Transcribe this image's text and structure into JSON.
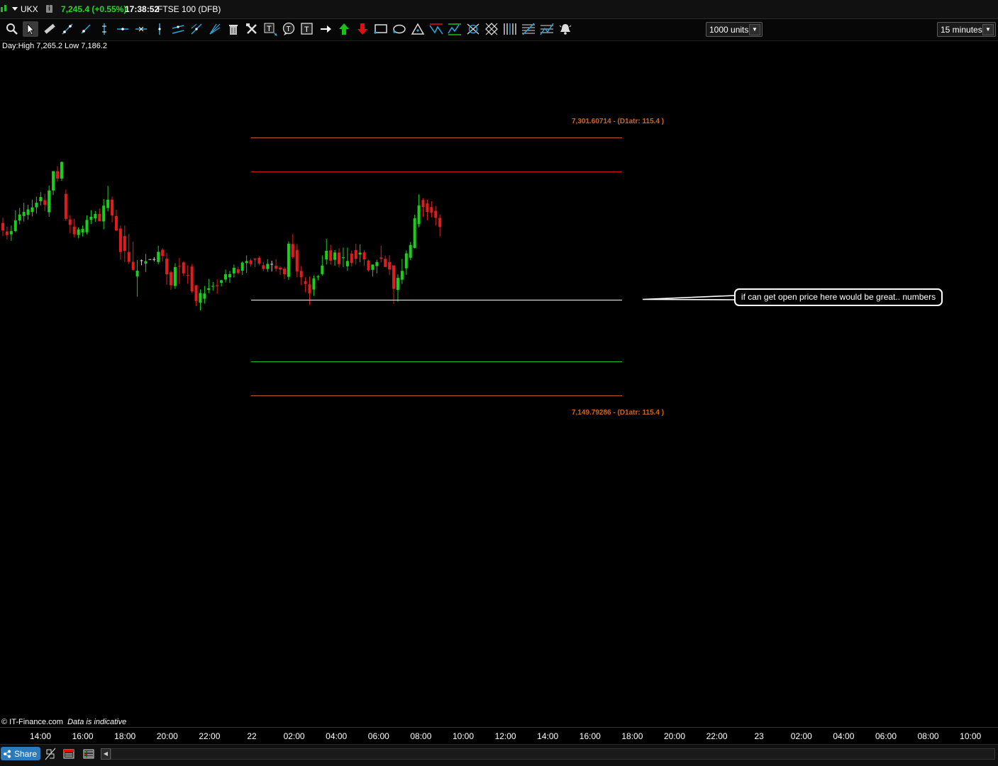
{
  "titlebar": {
    "symbol": "UKX",
    "info_glyph": "i",
    "price_change": "7,245.4 (+0.55%)",
    "time": "17:38:52",
    "instrument": "FTSE 100 (DFB)"
  },
  "toolbar": {
    "units_label": "1000 units",
    "timeframe_label": "15 minutes",
    "text_tool_glyph": "T",
    "colors": {
      "up_arrow": "#19c019",
      "down_arrow": "#e01010",
      "icon": "#2aa9e0"
    }
  },
  "day_high_low": "Day:High 7,265.2 Low 7,186.2",
  "atr_upper_label": "7,301.60714  - (D1atr: 115.4 )",
  "atr_lower_label": "7,149.79286  - (D1atr: 115.4 )",
  "callout_text": "if can get  open price here would be great.. numbers",
  "copyright": "© IT-Finance.com",
  "data_note": "Data is indicative",
  "share_label": "Share",
  "time_axis_labels": [
    "14:00",
    "16:00",
    "18:00",
    "20:00",
    "22:00",
    "22",
    "02:00",
    "04:00",
    "06:00",
    "08:00",
    "10:00",
    "12:00",
    "14:00",
    "16:00",
    "18:00",
    "20:00",
    "22:00",
    "23",
    "02:00",
    "04:00",
    "06:00",
    "08:00",
    "10:00"
  ],
  "chart_data": {
    "type": "candlestick",
    "symbol": "UKX",
    "timeframe": "15 minutes",
    "day_high": 7265.2,
    "day_low": 7186.2,
    "last_price": 7245.4,
    "levels": [
      {
        "name": "atr_upper",
        "value": 7301.60714,
        "color": "#d45f1c"
      },
      {
        "name": "red_line",
        "value": 7285.0,
        "color": "#e01010"
      },
      {
        "name": "open_price",
        "value": 7225.7,
        "color": "#ffffff"
      },
      {
        "name": "green_line",
        "value": 7166.4,
        "color": "#19c019"
      },
      {
        "name": "atr_lower",
        "value": 7149.79286,
        "color": "#d45f1c"
      }
    ],
    "colors": {
      "up": "#19d019",
      "down": "#e01c1c",
      "doji": "#cfcfcf"
    },
    "candles": [
      {
        "o": 7251.5,
        "h": 7254.6,
        "l": 7243.8,
        "c": 7247.1
      },
      {
        "o": 7246.5,
        "h": 7249.3,
        "l": 7241.8,
        "c": 7244.4
      },
      {
        "o": 7244.8,
        "h": 7250.0,
        "l": 7240.9,
        "c": 7246.7
      },
      {
        "o": 7246.7,
        "h": 7259.0,
        "l": 7246.0,
        "c": 7253.0
      },
      {
        "o": 7253.0,
        "h": 7260.4,
        "l": 7250.7,
        "c": 7256.5
      },
      {
        "o": 7255.6,
        "h": 7263.4,
        "l": 7252.4,
        "c": 7258.0
      },
      {
        "o": 7256.3,
        "h": 7262.2,
        "l": 7253.5,
        "c": 7259.5
      },
      {
        "o": 7258.0,
        "h": 7265.2,
        "l": 7255.3,
        "c": 7260.7
      },
      {
        "o": 7260.7,
        "h": 7267.0,
        "l": 7257.0,
        "c": 7263.4
      },
      {
        "o": 7264.3,
        "h": 7269.6,
        "l": 7261.8,
        "c": 7266.8
      },
      {
        "o": 7264.9,
        "h": 7268.6,
        "l": 7258.5,
        "c": 7262.2
      },
      {
        "o": 7257.8,
        "h": 7273.6,
        "l": 7255.1,
        "c": 7270.6
      },
      {
        "o": 7270.6,
        "h": 7281.7,
        "l": 7267.9,
        "c": 7282.0
      },
      {
        "o": 7282.0,
        "h": 7285.0,
        "l": 7275.8,
        "c": 7277.6
      },
      {
        "o": 7277.6,
        "h": 7287.7,
        "l": 7276.3,
        "c": 7287.4
      },
      {
        "o": 7268.6,
        "h": 7271.2,
        "l": 7252.7,
        "c": 7253.9
      },
      {
        "o": 7253.6,
        "h": 7256.2,
        "l": 7245.5,
        "c": 7250.3
      },
      {
        "o": 7249.4,
        "h": 7254.0,
        "l": 7243.1,
        "c": 7244.8
      },
      {
        "o": 7244.4,
        "h": 7248.9,
        "l": 7242.4,
        "c": 7247.7
      },
      {
        "o": 7245.9,
        "h": 7250.0,
        "l": 7243.5,
        "c": 7248.0
      },
      {
        "o": 7246.0,
        "h": 7256.0,
        "l": 7244.8,
        "c": 7253.3
      },
      {
        "o": 7253.3,
        "h": 7259.0,
        "l": 7250.9,
        "c": 7255.1
      },
      {
        "o": 7254.2,
        "h": 7258.5,
        "l": 7252.2,
        "c": 7256.8
      },
      {
        "o": 7256.8,
        "h": 7260.0,
        "l": 7252.4,
        "c": 7252.5
      },
      {
        "o": 7252.4,
        "h": 7265.6,
        "l": 7247.8,
        "c": 7261.7
      },
      {
        "o": 7260.3,
        "h": 7273.3,
        "l": 7258.3,
        "c": 7265.2
      },
      {
        "o": 7265.2,
        "h": 7267.0,
        "l": 7251.9,
        "c": 7255.9
      },
      {
        "o": 7255.6,
        "h": 7259.3,
        "l": 7246.7,
        "c": 7247.1
      },
      {
        "o": 7248.2,
        "h": 7250.0,
        "l": 7229.9,
        "c": 7234.4
      },
      {
        "o": 7243.8,
        "h": 7250.0,
        "l": 7228.5,
        "c": 7235.0
      },
      {
        "o": 7234.4,
        "h": 7245.0,
        "l": 7227.3,
        "c": 7228.6
      },
      {
        "o": 7228.6,
        "h": 7240.6,
        "l": 7223.5,
        "c": 7223.9
      },
      {
        "o": 7220.0,
        "h": 7229.6,
        "l": 7208.1,
        "c": 7223.4
      },
      {
        "o": 7229.5,
        "h": 7230.0,
        "l": 7226.6,
        "c": 7229.5
      },
      {
        "o": 7227.6,
        "h": 7233.3,
        "l": 7222.7,
        "c": 7229.0
      },
      {
        "o": 7230.2,
        "h": 7230.2,
        "l": 7230.2,
        "c": 7230.2
      },
      {
        "o": 7230.2,
        "h": 7231.4,
        "l": 7228.9,
        "c": 7230.2
      },
      {
        "o": 7228.5,
        "h": 7238.1,
        "l": 7227.1,
        "c": 7234.5
      },
      {
        "o": 7235.7,
        "h": 7236.6,
        "l": 7228.9,
        "c": 7232.1
      },
      {
        "o": 7230.5,
        "h": 7233.9,
        "l": 7215.1,
        "c": 7221.3
      },
      {
        "o": 7222.5,
        "h": 7223.4,
        "l": 7212.1,
        "c": 7214.8
      },
      {
        "o": 7214.4,
        "h": 7227.8,
        "l": 7212.7,
        "c": 7225.5
      },
      {
        "o": 7226.2,
        "h": 7230.9,
        "l": 7215.6,
        "c": 7225.8
      },
      {
        "o": 7228.3,
        "h": 7229.0,
        "l": 7220.3,
        "c": 7221.8
      },
      {
        "o": 7221.0,
        "h": 7226.5,
        "l": 7215.7,
        "c": 7220.6
      },
      {
        "o": 7225.8,
        "h": 7227.3,
        "l": 7210.4,
        "c": 7211.3
      },
      {
        "o": 7214.8,
        "h": 7215.0,
        "l": 7202.6,
        "c": 7205.5
      },
      {
        "o": 7204.6,
        "h": 7212.4,
        "l": 7200.0,
        "c": 7210.3
      },
      {
        "o": 7206.9,
        "h": 7214.4,
        "l": 7204.0,
        "c": 7210.0
      },
      {
        "o": 7212.1,
        "h": 7218.5,
        "l": 7210.2,
        "c": 7213.1
      },
      {
        "o": 7214.0,
        "h": 7216.8,
        "l": 7211.6,
        "c": 7214.5
      },
      {
        "o": 7214.8,
        "h": 7218.3,
        "l": 7209.8,
        "c": 7214.2
      },
      {
        "o": 7216.3,
        "h": 7218.1,
        "l": 7214.1,
        "c": 7217.8
      },
      {
        "o": 7218.2,
        "h": 7224.1,
        "l": 7216.5,
        "c": 7221.3
      },
      {
        "o": 7219.5,
        "h": 7223.3,
        "l": 7216.3,
        "c": 7221.4
      },
      {
        "o": 7221.8,
        "h": 7227.0,
        "l": 7219.4,
        "c": 7225.1
      },
      {
        "o": 7224.2,
        "h": 7225.8,
        "l": 7221.3,
        "c": 7222.1
      },
      {
        "o": 7223.4,
        "h": 7228.9,
        "l": 7220.9,
        "c": 7228.2
      },
      {
        "o": 7227.9,
        "h": 7232.4,
        "l": 7222.1,
        "c": 7229.1
      },
      {
        "o": 7229.5,
        "h": 7230.6,
        "l": 7225.8,
        "c": 7227.3
      },
      {
        "o": 7230.6,
        "h": 7230.6,
        "l": 7225.5,
        "c": 7229.9
      },
      {
        "o": 7231.0,
        "h": 7231.8,
        "l": 7226.6,
        "c": 7227.6
      },
      {
        "o": 7226.6,
        "h": 7228.5,
        "l": 7223.2,
        "c": 7224.4
      },
      {
        "o": 7224.4,
        "h": 7230.2,
        "l": 7222.7,
        "c": 7227.4
      },
      {
        "o": 7227.4,
        "h": 7229.3,
        "l": 7223.0,
        "c": 7227.3
      },
      {
        "o": 7226.3,
        "h": 7230.2,
        "l": 7223.1,
        "c": 7224.6
      },
      {
        "o": 7225.2,
        "h": 7226.2,
        "l": 7220.8,
        "c": 7224.1
      },
      {
        "o": 7224.6,
        "h": 7225.7,
        "l": 7218.5,
        "c": 7221.3
      },
      {
        "o": 7219.8,
        "h": 7240.6,
        "l": 7218.0,
        "c": 7239.3
      },
      {
        "o": 7239.1,
        "h": 7245.0,
        "l": 7230.5,
        "c": 7231.4
      },
      {
        "o": 7235.6,
        "h": 7239.0,
        "l": 7219.5,
        "c": 7223.0
      },
      {
        "o": 7223.3,
        "h": 7226.1,
        "l": 7214.9,
        "c": 7219.5
      },
      {
        "o": 7217.2,
        "h": 7219.5,
        "l": 7210.7,
        "c": 7215.6
      },
      {
        "o": 7215.4,
        "h": 7220.0,
        "l": 7203.3,
        "c": 7210.0
      },
      {
        "o": 7212.3,
        "h": 7220.6,
        "l": 7208.6,
        "c": 7218.8
      },
      {
        "o": 7219.5,
        "h": 7220.9,
        "l": 7217.7,
        "c": 7220.0
      },
      {
        "o": 7221.4,
        "h": 7232.4,
        "l": 7220.6,
        "c": 7226.4
      },
      {
        "o": 7230.0,
        "h": 7242.1,
        "l": 7227.0,
        "c": 7235.1
      },
      {
        "o": 7235.4,
        "h": 7238.6,
        "l": 7227.0,
        "c": 7229.3
      },
      {
        "o": 7229.8,
        "h": 7235.6,
        "l": 7226.3,
        "c": 7234.1
      },
      {
        "o": 7234.1,
        "h": 7236.6,
        "l": 7225.3,
        "c": 7227.3
      },
      {
        "o": 7230.8,
        "h": 7237.0,
        "l": 7225.5,
        "c": 7231.3
      },
      {
        "o": 7226.0,
        "h": 7237.0,
        "l": 7223.4,
        "c": 7229.1
      },
      {
        "o": 7233.5,
        "h": 7235.2,
        "l": 7225.8,
        "c": 7227.9
      },
      {
        "o": 7235.6,
        "h": 7239.3,
        "l": 7227.0,
        "c": 7230.4
      },
      {
        "o": 7232.9,
        "h": 7239.0,
        "l": 7228.4,
        "c": 7234.0
      },
      {
        "o": 7234.2,
        "h": 7235.6,
        "l": 7226.2,
        "c": 7230.0
      },
      {
        "o": 7229.4,
        "h": 7230.0,
        "l": 7222.8,
        "c": 7223.6
      },
      {
        "o": 7223.9,
        "h": 7227.1,
        "l": 7220.0,
        "c": 7227.0
      },
      {
        "o": 7226.1,
        "h": 7229.9,
        "l": 7221.8,
        "c": 7228.5
      },
      {
        "o": 7231.2,
        "h": 7238.1,
        "l": 7228.2,
        "c": 7230.4
      },
      {
        "o": 7230.4,
        "h": 7232.3,
        "l": 7225.6,
        "c": 7225.6
      },
      {
        "o": 7228.5,
        "h": 7232.5,
        "l": 7220.8,
        "c": 7224.1
      },
      {
        "o": 7226.5,
        "h": 7226.7,
        "l": 7203.8,
        "c": 7212.7
      },
      {
        "o": 7212.1,
        "h": 7221.3,
        "l": 7205.1,
        "c": 7219.2
      },
      {
        "o": 7218.1,
        "h": 7230.4,
        "l": 7215.6,
        "c": 7223.3
      },
      {
        "o": 7224.8,
        "h": 7235.3,
        "l": 7221.0,
        "c": 7233.6
      },
      {
        "o": 7231.0,
        "h": 7240.3,
        "l": 7229.6,
        "c": 7238.5
      },
      {
        "o": 7236.8,
        "h": 7256.4,
        "l": 7236.5,
        "c": 7254.2
      },
      {
        "o": 7250.8,
        "h": 7268.3,
        "l": 7249.0,
        "c": 7261.8
      },
      {
        "o": 7265.0,
        "h": 7266.0,
        "l": 7255.0,
        "c": 7260.9
      },
      {
        "o": 7263.0,
        "h": 7265.1,
        "l": 7253.1,
        "c": 7258.0
      },
      {
        "o": 7260.9,
        "h": 7264.3,
        "l": 7254.8,
        "c": 7257.5
      },
      {
        "o": 7258.6,
        "h": 7261.5,
        "l": 7250.0,
        "c": 7254.5
      },
      {
        "o": 7254.5,
        "h": 7256.5,
        "l": 7243.5,
        "c": 7249.1
      }
    ]
  }
}
